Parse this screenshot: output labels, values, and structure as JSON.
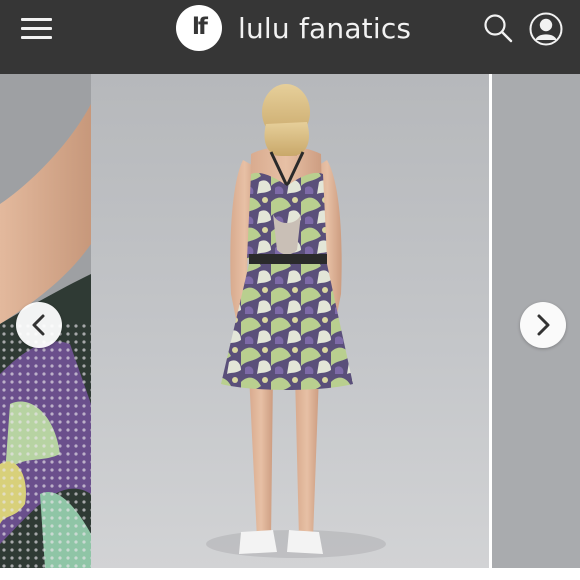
{
  "header": {
    "logo_text": "lf",
    "brand_name": "lulu fanatics",
    "background": "#363636",
    "text_color": "#f2f2f2"
  },
  "icons": {
    "menu": "hamburger-menu-icon",
    "search": "search-icon",
    "profile": "user-profile-icon",
    "prev": "chevron-left-icon",
    "next": "chevron-right-icon"
  },
  "carousel": {
    "main_image": "woman in purple and green print dress with open back, rear view",
    "prev_image": "close-up of dress print fabric",
    "next_image": "partial next product photo"
  }
}
